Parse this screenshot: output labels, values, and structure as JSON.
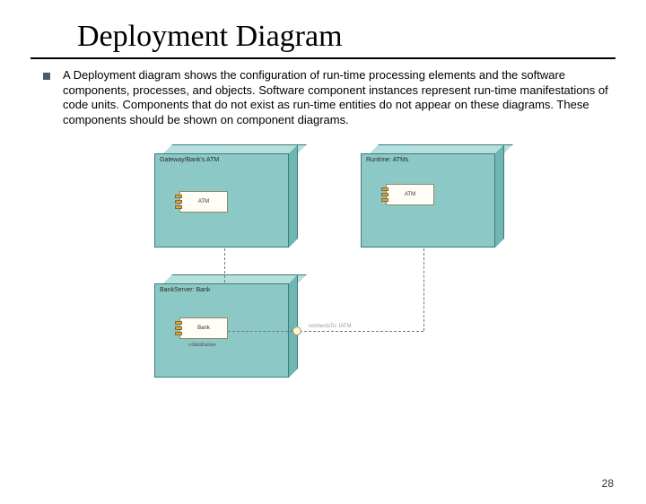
{
  "title": "Deployment Diagram",
  "bullet_text": "A Deployment diagram shows the configuration of run-time processing elements and the software components, processes, and objects. Software component instances represent run-time manifestations of code units. Components that do not exist as run-time entities do not appear on these diagrams. These components should be shown on component diagrams.",
  "nodes": {
    "topleft": {
      "label": "Gateway/Bank's ATM",
      "component": "ATM"
    },
    "topright": {
      "label": "Runtime: ATMs",
      "component": "ATM"
    },
    "bottomleft": {
      "label": "BankServer: Bank",
      "component": "Bank",
      "sub": "«database»"
    }
  },
  "interface_label": "connectsTo: IATM",
  "page_number": "28"
}
